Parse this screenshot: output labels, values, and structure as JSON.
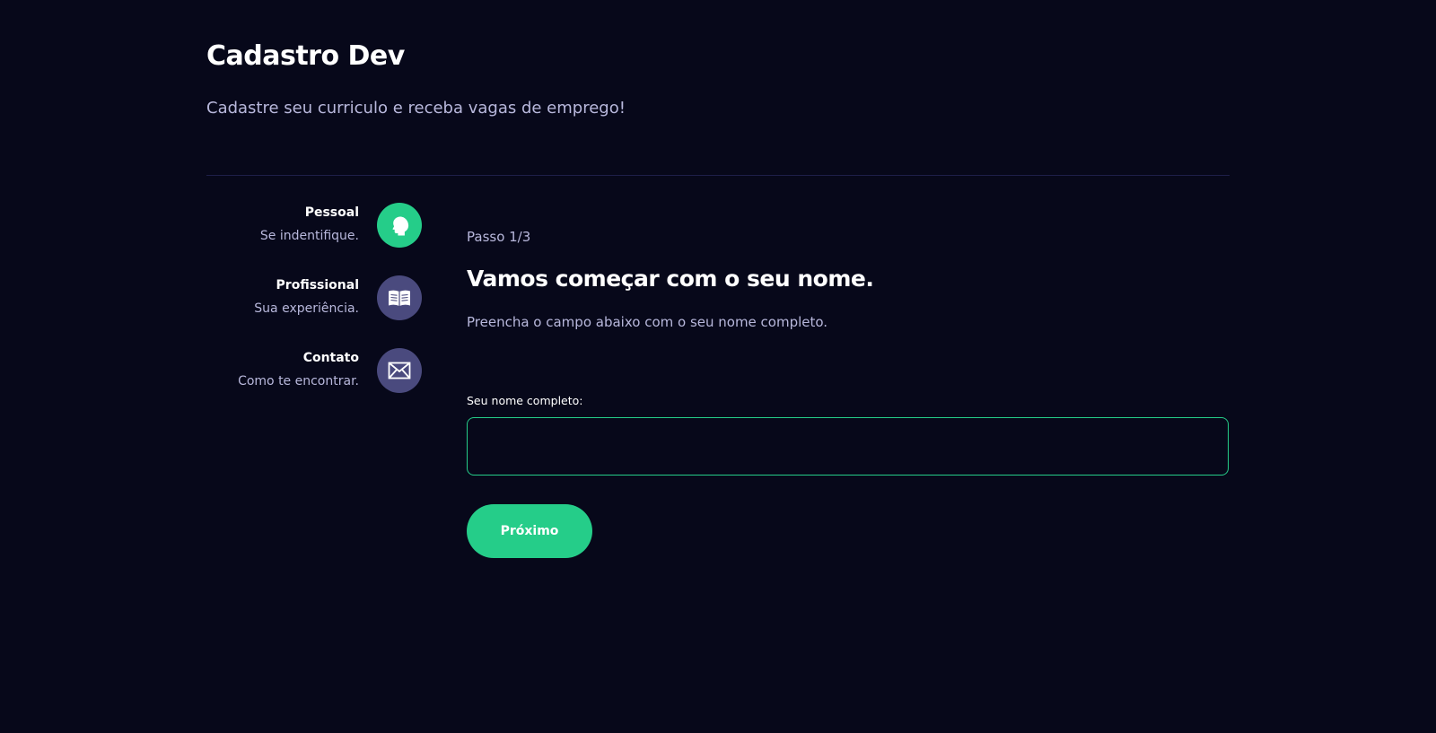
{
  "header": {
    "title": "Cadastro Dev",
    "subtitle": "Cadastre seu curriculo e receba vagas de emprego!"
  },
  "steps": [
    {
      "title": "Pessoal",
      "description": "Se indentifique.",
      "icon": "profile-head-icon",
      "active": true
    },
    {
      "title": "Profissional",
      "description": "Sua experiência.",
      "icon": "book-icon",
      "active": false
    },
    {
      "title": "Contato",
      "description": "Como te encontrar.",
      "icon": "mail-icon",
      "active": false
    }
  ],
  "main": {
    "step_counter": "Passo 1/3",
    "title": "Vamos começar com o seu nome.",
    "description": "Preencha o campo abaixo com o seu nome completo.",
    "field_label": "Seu nome completo:",
    "field_value": "",
    "next_label": "Próximo"
  },
  "colors": {
    "background": "#07081a",
    "accent": "#25cd89",
    "inactive_icon_bg": "#4a4a7e",
    "muted_text": "#b8b8dc",
    "divider": "#1e1f48"
  }
}
